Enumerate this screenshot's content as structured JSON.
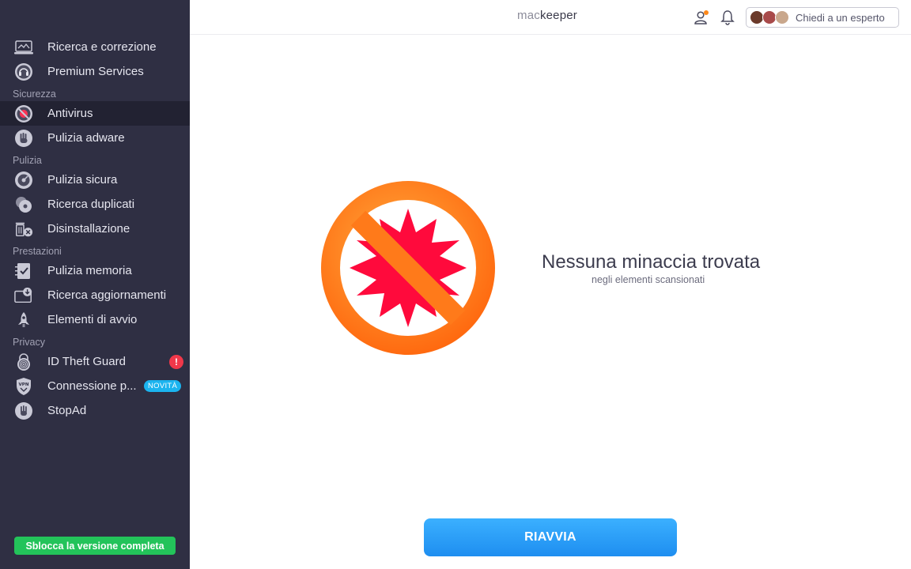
{
  "sidebar": {
    "items": [
      {
        "label": "Ricerca e correzione",
        "icon": "laptop-scan-icon"
      },
      {
        "label": "Premium Services",
        "icon": "headset-icon"
      }
    ],
    "sections": [
      {
        "title": "Sicurezza",
        "items": [
          {
            "label": "Antivirus",
            "icon": "virus-block-icon",
            "active": true
          },
          {
            "label": "Pulizia adware",
            "icon": "hand-stop-icon"
          }
        ]
      },
      {
        "title": "Pulizia",
        "items": [
          {
            "label": "Pulizia sicura",
            "icon": "disk-clean-icon"
          },
          {
            "label": "Ricerca duplicati",
            "icon": "duplicates-icon"
          },
          {
            "label": "Disinstallazione",
            "icon": "trash-remove-icon"
          }
        ]
      },
      {
        "title": "Prestazioni",
        "items": [
          {
            "label": "Pulizia memoria",
            "icon": "memory-check-icon"
          },
          {
            "label": "Ricerca aggiornamenti",
            "icon": "update-download-icon"
          },
          {
            "label": "Elementi di avvio",
            "icon": "rocket-icon"
          }
        ]
      },
      {
        "title": "Privacy",
        "items": [
          {
            "label": "ID Theft Guard",
            "icon": "fingerprint-lock-icon",
            "badge": "!"
          },
          {
            "label": "Connessione p...",
            "icon": "vpn-shield-icon",
            "badge_new": "NOVITÀ"
          },
          {
            "label": "StopAd",
            "icon": "stopad-hand-icon"
          }
        ]
      }
    ],
    "unlock_label": "Sblocca la versione completa"
  },
  "header": {
    "logo_mac": "mac",
    "logo_keeper": "keeper",
    "expert_label": "Chiedi a un esperto"
  },
  "main": {
    "title": "Nessuna minaccia trovata",
    "subtitle": "negli elementi scansionati",
    "restart_label": "RIAVVIA"
  },
  "colors": {
    "sidebar_bg": "#2f2f43",
    "active_bg": "#222232",
    "accent_blue": "#1e8ef0",
    "unlock_green": "#23c35a",
    "alert_red": "#f0384a",
    "new_badge": "#1bb4ef",
    "ban_orange": "#ff7a1a",
    "virus_red": "#ff0a3c"
  }
}
